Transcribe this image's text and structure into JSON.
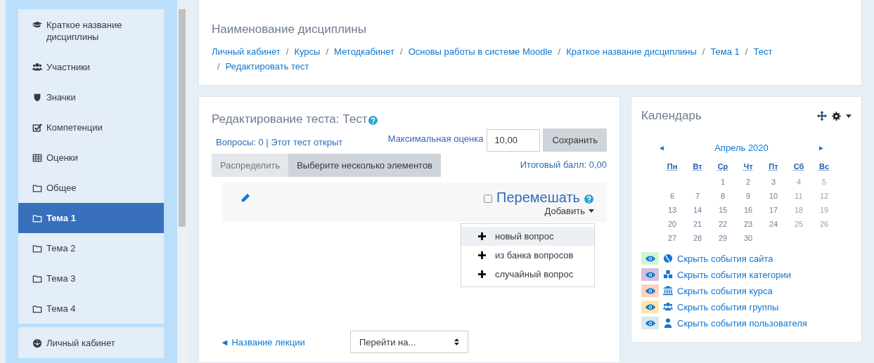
{
  "sidebar": {
    "items": [
      {
        "label": "Краткое название дисциплины",
        "selected": false
      },
      {
        "label": "Участники",
        "selected": false
      },
      {
        "label": "Значки",
        "selected": false
      },
      {
        "label": "Компетенции",
        "selected": false
      },
      {
        "label": "Оценки",
        "selected": false
      },
      {
        "label": "Общее",
        "selected": false
      },
      {
        "label": "Тема 1",
        "selected": true
      },
      {
        "label": "Тема 2",
        "selected": false
      },
      {
        "label": "Тема 3",
        "selected": false
      },
      {
        "label": "Тема 4",
        "selected": false
      }
    ],
    "footer_items": [
      {
        "label": "Личный кабинет",
        "selected": false
      }
    ]
  },
  "header": {
    "title": "Наименование дисциплины",
    "separator": "/",
    "breadcrumb": [
      "Личный кабинет",
      "Курсы",
      "Методкабинет",
      "Основы работы в системе Moodle",
      "Краткое название дисциплины",
      "Тема 1",
      "Тест",
      "Редактировать тест"
    ]
  },
  "editor": {
    "title": "Редактирование теста: Тест",
    "info": "Вопросы: 0 | Этот тест открыт",
    "max_grade_label": "Максимальная оценка",
    "max_grade_value": "10,00",
    "save_button": "Сохранить",
    "buttons": [
      {
        "label": "Распределить",
        "disabled": true
      },
      {
        "label": "Выберите несколько элементов",
        "disabled": false
      }
    ],
    "total": "Итоговый балл: 0,00",
    "shuffle": {
      "label": "Перемешать",
      "checked": false
    },
    "add_button": "Добавить",
    "add_menu": [
      {
        "label": "новый вопрос",
        "highlighted": true
      },
      {
        "label": "из банка вопросов",
        "highlighted": false
      },
      {
        "label": "случайный вопрос",
        "highlighted": false
      }
    ],
    "prev_link": "◄ Название лекции",
    "jump_select": "Перейти на..."
  },
  "calendar": {
    "title": "Календарь",
    "month": "Апрель 2020",
    "prev": "◄",
    "next": "►",
    "weekdays": [
      "Пн",
      "Вт",
      "Ср",
      "Чт",
      "Пт",
      "Сб",
      "Вс"
    ],
    "weeks": [
      [
        "1",
        "2",
        "3",
        "4",
        "5"
      ],
      [
        "6",
        "7",
        "8",
        "9",
        "10",
        "11",
        "12"
      ],
      [
        "13",
        "14",
        "15",
        "16",
        "17",
        "18",
        "19"
      ],
      [
        "20",
        "21",
        "22",
        "23",
        "24",
        "25",
        "26"
      ],
      [
        "27",
        "28",
        "29",
        "30"
      ]
    ],
    "filters": [
      {
        "label": "Скрыть события сайта",
        "color": "#d1f5d1"
      },
      {
        "label": "Скрыть события категории",
        "color": "#d7c0dc"
      },
      {
        "label": "Скрыть события курса",
        "color": "#ffd3bd"
      },
      {
        "label": "Скрыть события группы",
        "color": "#fee7ae"
      },
      {
        "label": "Скрыть события пользователя",
        "color": "#dce7ec"
      }
    ]
  }
}
